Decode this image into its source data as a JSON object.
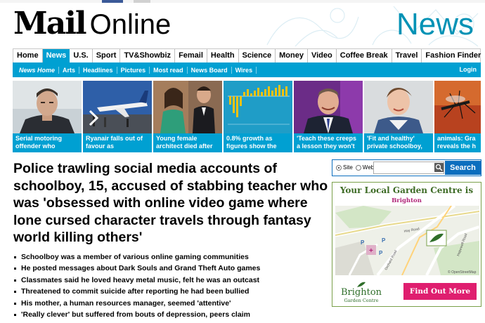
{
  "site": {
    "logo_main": "Mail",
    "logo_secondary": "Online",
    "section": "News"
  },
  "nav": {
    "items": [
      "Home",
      "News",
      "U.S.",
      "Sport",
      "TV&Showbiz",
      "Femail",
      "Health",
      "Science",
      "Money",
      "Video",
      "Coffee Break",
      "Travel",
      "Fashion Finder"
    ],
    "active": "News"
  },
  "subnav": {
    "items": [
      "News Home",
      "Arts",
      "Headlines",
      "Pictures",
      "Most read",
      "News Board",
      "Wires"
    ],
    "login": "Login"
  },
  "strip": {
    "cards": [
      {
        "caption": "Serial motoring offender who"
      },
      {
        "caption": "Ryanair falls out of favour as"
      },
      {
        "caption": "Young female architect died after"
      },
      {
        "caption": "0.8% growth as figures show the"
      },
      {
        "caption": "'Teach these creeps a lesson they won't"
      },
      {
        "caption": "'Fit and healthy' private schoolboy,"
      },
      {
        "caption": "animals: Gra reveals the h"
      }
    ]
  },
  "article": {
    "headline": "Police trawling social media accounts of schoolboy, 15, accused of stabbing teacher who was 'obsessed with online video game where lone cursed character travels through fantasy world killing others'",
    "bullets": [
      "Schoolboy was a member of various online gaming communities",
      "He posted messages about Dark Souls and Grand Theft Auto games",
      "Classmates said he loved heavy metal music, felt he was an outcast",
      "Threatened to commit suicide after reporting he had been bullied",
      "His mother, a human resources manager, seemed 'attentive'",
      "'Really clever' but suffered from bouts of depression, peers claim"
    ]
  },
  "search": {
    "site_label": "Site",
    "web_label": "Web",
    "button": "Search",
    "value": ""
  },
  "ad": {
    "title": "Your Local Garden Centre is",
    "location": "Brighton",
    "brand": "Brighton",
    "brand_sub": "Garden Centre",
    "cta": "Find Out More",
    "map_labels": [
      "Hay Road",
      "Hopewell Road",
      "Orchard Road",
      "© OpenStreetMap"
    ]
  },
  "colors": {
    "brand_blue": "#00a0d2",
    "section_blue": "#0092b5",
    "search_blue": "#0b6ebe",
    "ad_cta": "#df1e6f",
    "ad_green": "#3c6a24"
  }
}
